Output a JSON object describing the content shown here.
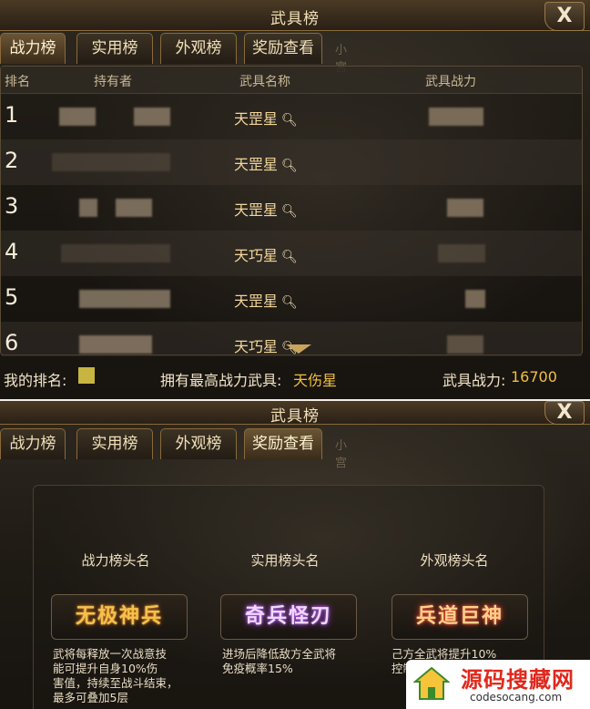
{
  "window": {
    "title": "武具榜",
    "close_label": "X"
  },
  "tabs": [
    {
      "label": "战力榜"
    },
    {
      "label": "实用榜"
    },
    {
      "label": "外观榜"
    },
    {
      "label": "奖励查看"
    }
  ],
  "tab_deco_text": "小宫",
  "table": {
    "headers": [
      "排名",
      "持有者",
      "武具名称",
      "武具战力"
    ],
    "rows": [
      {
        "rank": "1",
        "weapon": "天罡星"
      },
      {
        "rank": "2",
        "weapon": "天罡星"
      },
      {
        "rank": "3",
        "weapon": "天罡星"
      },
      {
        "rank": "4",
        "weapon": "天巧星"
      },
      {
        "rank": "5",
        "weapon": "天罡星"
      },
      {
        "rank": "6",
        "weapon": "天巧星"
      }
    ]
  },
  "footer": {
    "my_rank_label": "我的排名:",
    "best_weapon_label": "拥有最高战力武具:",
    "best_weapon_value": "天伤星",
    "weapon_power_label": "武具战力:",
    "weapon_power_value": "16700"
  },
  "rewards": [
    {
      "column_title": "战力榜头名",
      "badge": "无极神兵",
      "badge_style": "gold",
      "desc": [
        "武将每释放一次战意技",
        "能可提升自身10%伤",
        "害值，持续至战斗结束，",
        "最多可叠加5层"
      ]
    },
    {
      "column_title": "实用榜头名",
      "badge": "奇兵怪刃",
      "badge_style": "purple",
      "desc": [
        "进场后降低敌方全武将",
        "免疫概率15%"
      ]
    },
    {
      "column_title": "外观榜头名",
      "badge": "兵道巨神",
      "badge_style": "red",
      "desc": [
        "己方全武将提升10%",
        "控制"
      ]
    }
  ],
  "watermark": {
    "title": "源码搜藏网",
    "subtitle": "codesocang.com"
  },
  "colors": {
    "accent_gold": "#f0c040",
    "title_text": "#f4e2b8",
    "frame": "#8a6a3a"
  }
}
